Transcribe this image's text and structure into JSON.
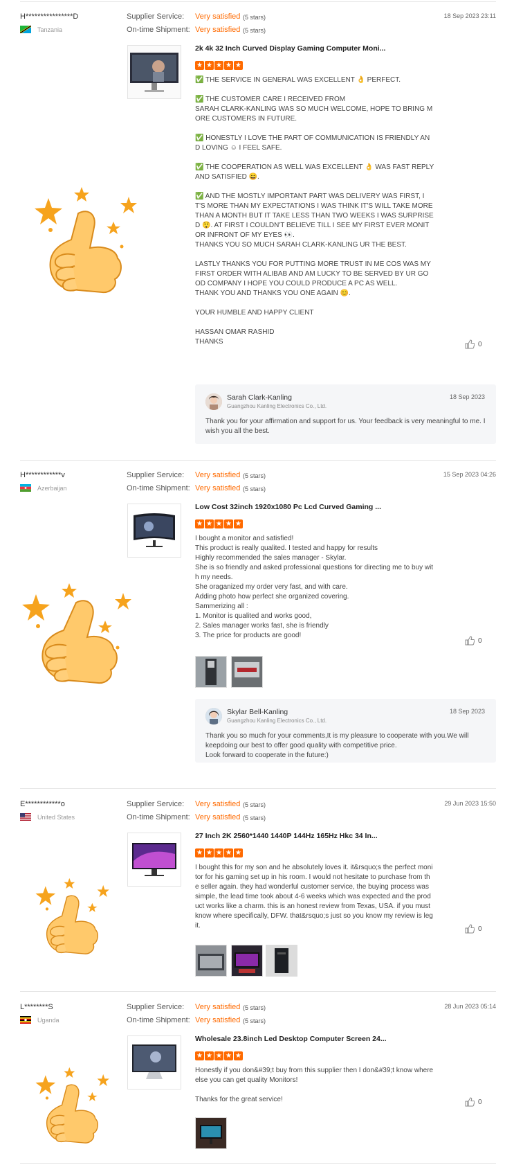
{
  "labels": {
    "supplier_service": "Supplier Service:",
    "ontime_shipment": "On-time Shipment:",
    "satisfied": "Very satisfied",
    "stars5": "(5 stars)"
  },
  "colors": {
    "accent": "#ff6a00",
    "divider": "#e6e6e6",
    "reply_bg": "#f5f6f8"
  },
  "reviews": [
    {
      "name": "H****************D",
      "country": "Tanzania",
      "date": "18 Sep 2023 23:11",
      "product_title": "2k 4k 32 Inch Curved Display Gaming Computer Moni...",
      "body": "✅ THE SERVICE IN GENERAL WAS EXCELLENT 👌 PERFECT.\n\n✅ THE CUSTOMER CARE I RECEIVED FROM\nSARAH CLARK-KANLING WAS SO MUCH WELCOME, HOPE TO BRING MORE CUSTOMERS IN FUTURE.\n\n✅ HONESTLY I LOVE THE PART OF COMMUNICATION IS FRIENDLY AND LOVING ☺ I FEEL SAFE.\n\n✅ THE COOPERATION AS WELL WAS EXCELLENT 👌 WAS FAST REPLY AND SATISFIED 😄.\n\n✅ AND THE MOSTLY IMPORTANT PART WAS DELIVERY WAS FIRST, IT'S MORE THAN MY EXPECTATIONS I WAS THINK IT'S WILL TAKE MORE THAN A MONTH BUT IT TAKE LESS THAN TWO WEEKS I WAS SURPRISED 😲. AT FIRST I COULDN'T BELIEVE TILL I SEE MY FIRST EVER MONITOR INFRONT OF MY EYES 👀.\nTHANKS YOU SO MUCH SARAH CLARK-KANLING UR THE BEST.\n\nLASTLY THANKS YOU FOR PUTTING MORE TRUST IN ME COS WAS MY FIRST ORDER WITH ALIBAB AND AM LUCKY TO BE SERVED BY UR GOOD COMPANY I HOPE YOU COULD PRODUCE A PC AS WELL.\nTHANK YOU AND THANKS YOU ONE AGAIN 😊.\n\nYOUR HUMBLE AND HAPPY CLIENT\n\nHASSAN OMAR RASHID\nTHANKS",
      "likes": "0",
      "reply": {
        "name": "Sarah Clark-Kanling",
        "company": "Guangzhou Kanling Electronics Co., Ltd.",
        "date": "18 Sep 2023",
        "text": "Thank you for your affirmation and support for us. Your feedback is very meaningful to me. I wish you all the best."
      }
    },
    {
      "name": "H************v",
      "country": "Azerbaijan",
      "date": "15 Sep 2023 04:26",
      "product_title": "Low Cost 32inch 1920x1080 Pc Lcd Curved Gaming ...",
      "body": "I bought a monitor and satisfied!\nThis product is really qualited. I tested and happy for results\nHighly recommended the sales manager - Skylar.\nShe is so friendly and asked professional questions for directing me to buy with my needs.\nShe oraganized my order very fast, and with care.\nAdding photo how perfect she organized covering.\nSammerizing all :\n1. Monitor is qualited and works good,\n2. Sales manager works fast, she is friendly\n3. The price for products are good!",
      "likes": "0",
      "reply": {
        "name": "Skylar Bell-Kanling",
        "company": "Guangzhou Kanling Electronics Co., Ltd.",
        "date": "18 Sep 2023",
        "text": "Thank you so much for your comments,It is my pleasure to cooperate with you.We will keepdoing our best to offer good quality with competitive price.\nLook forward to cooperate in the future:)"
      }
    },
    {
      "name": "E************o",
      "country": "United States",
      "date": "29 Jun 2023 15:50",
      "product_title": "27 Inch 2K 2560*1440 1440P 144Hz 165Hz Hkc 34 In...",
      "body": "I bought this for my son and he absolutely loves it. it&rsquo;s the perfect monitor for his gaming set up in his room. I would not hesitate to purchase from the seller again. they had wonderful customer service, the buying process was simple, the lead time took about 4-6 weeks which was expected and the product works like a charm. this is an honest review from Texas, USA. if you must know where specifically, DFW. that&rsquo;s just so you know my review is legit.",
      "likes": "0"
    },
    {
      "name": "L********S",
      "country": "Uganda",
      "date": "28 Jun 2023 05:14",
      "product_title": "Wholesale 23.8inch Led Desktop Computer Screen 24...",
      "body": "Honestly if you don&#39;t buy from this supplier then I don&#39;t know where else you can get quality Monitors!\n\nThanks for the great service!",
      "likes": "0"
    }
  ]
}
